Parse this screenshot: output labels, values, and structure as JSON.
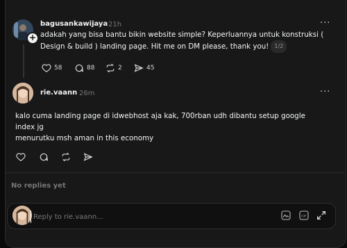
{
  "thread": {
    "original_post": {
      "username": "bagusankawijaya",
      "time": "21h",
      "text_line1": "adakah yang bisa bantu bikin website simple? Keperluannya untuk konstruksi (",
      "text_line2": "Design & build ) landing page. Hit me on DM please, thank you!",
      "page_indicator": "1/2",
      "likes": "58",
      "replies": "88",
      "reposts": "2",
      "shares": "45"
    },
    "reply_post": {
      "username": "rie.vaann",
      "time": "26m",
      "text_line1": "kalo cuma landing page di idwebhost aja kak, 700rban udh dibantu setup google",
      "text_line2": "index jg",
      "text_line3": "menurutku msh aman in this economy"
    },
    "more_glyph": "···",
    "no_replies_text": "No replies yet"
  },
  "composer": {
    "placeholder": "Reply to rie.vaann..."
  },
  "icons": {
    "like": "heart-icon",
    "comment": "comment-icon",
    "repost": "repost-icon",
    "share": "share-icon",
    "image": "image-icon",
    "gif": "gif-icon",
    "expand": "expand-icon"
  },
  "colors": {
    "background": "#181818",
    "text": "#f3f5f7",
    "muted": "#777777"
  }
}
